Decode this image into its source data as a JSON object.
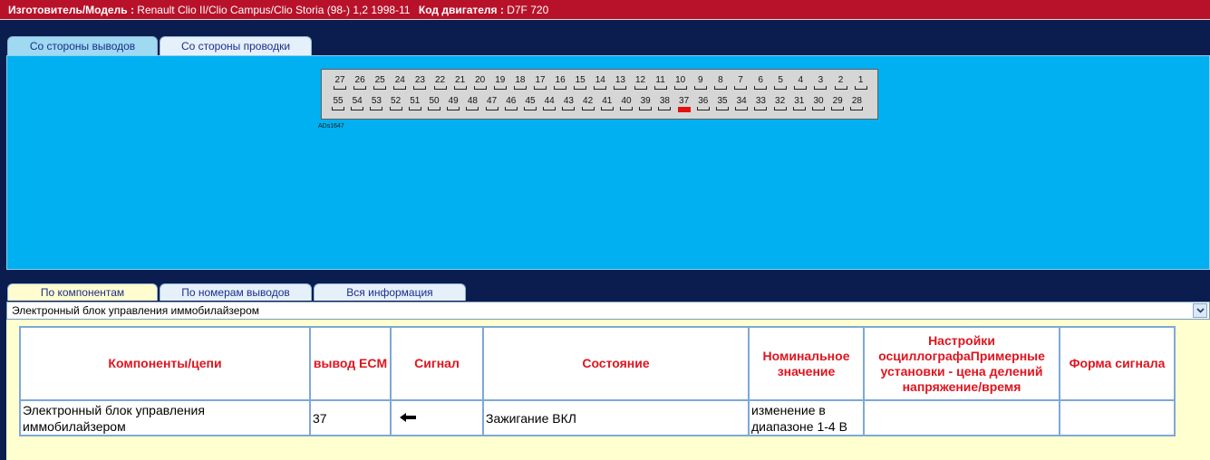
{
  "header": {
    "manufacturer_label": "Изготовитель/Модель :",
    "manufacturer_value": "Renault Clio II/Clio Campus/Clio Storia (98-) 1,2 1998-11",
    "engine_label": "Код двигателя :",
    "engine_value": "D7F 720"
  },
  "upper_tabs": [
    {
      "label": "Со стороны выводов",
      "active": true
    },
    {
      "label": "Со стороны проводки",
      "active": false
    }
  ],
  "connector": {
    "code": "ADs1647",
    "row1": [
      "27",
      "26",
      "25",
      "24",
      "23",
      "22",
      "21",
      "20",
      "19",
      "18",
      "17",
      "16",
      "15",
      "14",
      "13",
      "12",
      "11",
      "10",
      "9",
      "8",
      "7",
      "6",
      "5",
      "4",
      "3",
      "2",
      "1"
    ],
    "row2": [
      "55",
      "54",
      "53",
      "52",
      "51",
      "50",
      "49",
      "48",
      "47",
      "46",
      "45",
      "44",
      "43",
      "42",
      "41",
      "40",
      "39",
      "38",
      "37",
      "36",
      "35",
      "34",
      "33",
      "32",
      "31",
      "30",
      "29",
      "28"
    ],
    "highlighted_pin": "37",
    "highlight_color": "#e31010"
  },
  "lower_tabs": [
    {
      "label": "По компонентам",
      "active": true
    },
    {
      "label": "По номерам выводов",
      "active": false
    },
    {
      "label": "Вся информация",
      "active": false
    }
  ],
  "select": {
    "value": "Электронный блок управления иммобилайзером",
    "icon": "chevron-down-icon"
  },
  "table": {
    "headers": [
      "Компоненты/цепи",
      "вывод ECM",
      "Сигнал",
      "Состояние",
      "Номинальное значение",
      "Настройки осциллографаПримерные установки - цена делений напряжение/время",
      "Форма сигнала"
    ],
    "rows": [
      {
        "component": "Электронный блок управления иммобилайзером",
        "pin": "37",
        "signal_icon": "arrow-left-icon",
        "state": "Зажигание ВКЛ",
        "nominal": "изменение в диапазоне 1-4 В",
        "scope": "",
        "waveform": ""
      }
    ]
  },
  "colors": {
    "header_bg": "#b8122a",
    "page_bg": "#0a1d4e",
    "connector_panel_bg": "#00b0f0",
    "info_bg": "#ffffd0",
    "table_header_text": "#e0141e"
  }
}
